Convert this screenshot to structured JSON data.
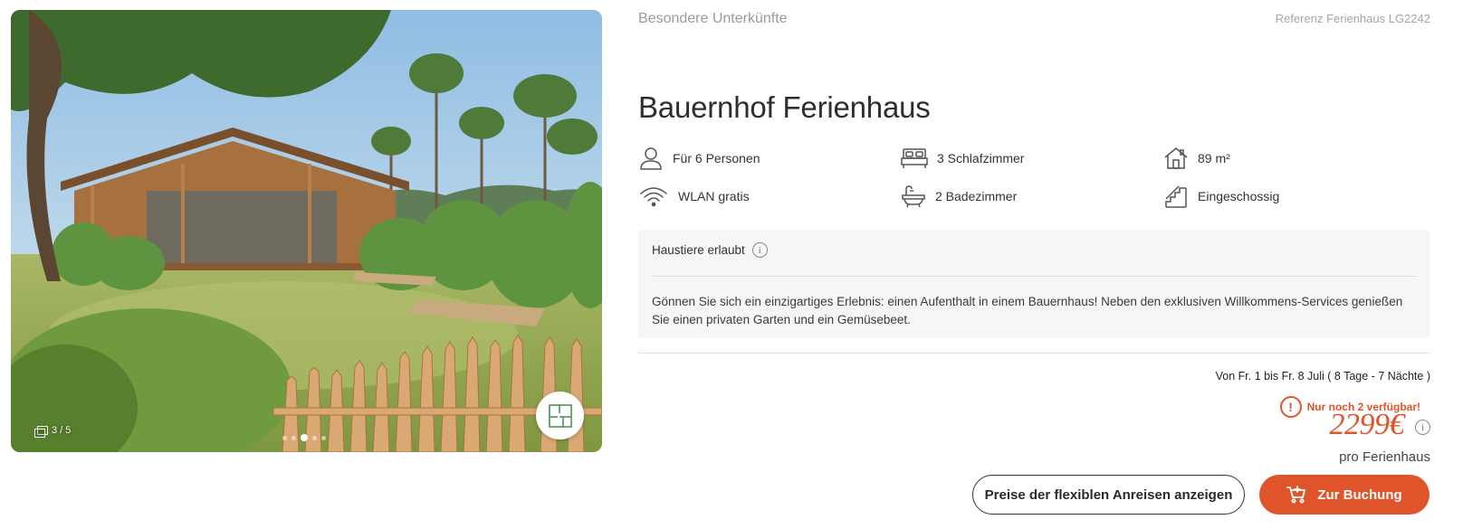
{
  "gallery": {
    "counter": "3 / 5",
    "dot_count": 5,
    "active_dot": 2,
    "icons": {
      "counter": "gallery-stack-icon",
      "floorplan": "floorplan-icon"
    }
  },
  "header": {
    "category": "Besondere Unterkünfte",
    "reference": "Referenz Ferienhaus LG2242"
  },
  "title": "Bauernhof Ferienhaus",
  "features": [
    {
      "label": "Für 6 Personen",
      "icon": "person-icon"
    },
    {
      "label": "3 Schlafzimmer",
      "icon": "bed-icon"
    },
    {
      "label": "89 m²",
      "icon": "house-icon"
    },
    {
      "label": "WLAN gratis",
      "icon": "wifi-icon"
    },
    {
      "label": "2 Badezimmer",
      "icon": "bathtub-icon"
    },
    {
      "label": "Eingeschossig",
      "icon": "stairs-icon"
    }
  ],
  "info": {
    "pets": "Haustiere erlaubt",
    "description": "Gönnen Sie sich ein einzigartiges Erlebnis: einen Aufenthalt in einem Bauernhaus! Neben den exklusiven Willkommens-Services genießen Sie einen privaten Garten und ein Gemüsebeet."
  },
  "booking": {
    "dates": "Von Fr. 1 bis Fr. 8 Juli ( 8 Tage - 7 Nächte )",
    "availability": "Nur noch 2 verfügbar!",
    "price": "2299€",
    "price_unit": "pro Ferienhaus",
    "flex_button": "Preise der flexiblen Anreisen anzeigen",
    "book_button": "Zur Buchung"
  },
  "colors": {
    "accent": "#e0542b",
    "muted": "#9a9a9a",
    "infobox": "#f6f6f6"
  }
}
